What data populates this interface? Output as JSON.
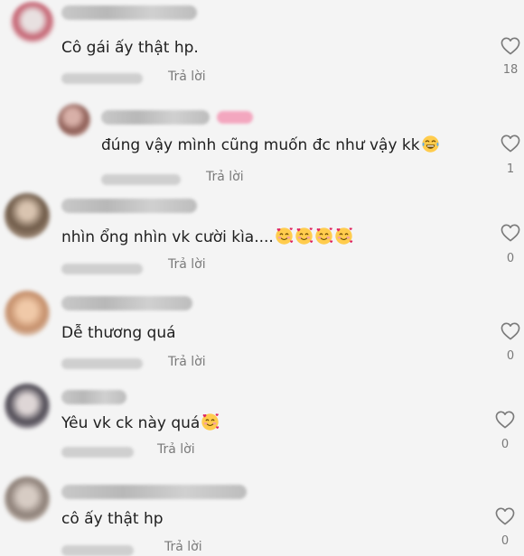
{
  "comments": [
    {
      "text": "Cô gái ấy thật hp.",
      "reply_label": "Trả lời",
      "likes": "18",
      "icon": "heart-outline-icon"
    },
    {
      "text": "đúng vậy mình cũng muốn đc như vậy kk",
      "reply_label": "Trả lời",
      "likes": "1",
      "icon": "heart-outline-icon",
      "emoji": "laughing-tears-emoji"
    },
    {
      "text": "nhìn ổng nhìn vk cười kìa....",
      "reply_label": "Trả lời",
      "likes": "0",
      "icon": "heart-outline-icon",
      "emoji": "smiling-face-with-hearts-emoji"
    },
    {
      "text": "Dễ thương quá",
      "reply_label": "Trả lời",
      "likes": "0",
      "icon": "heart-outline-icon"
    },
    {
      "text": "Yêu vk ck này quá",
      "reply_label": "Trả lời",
      "likes": "0",
      "icon": "heart-outline-icon",
      "emoji": "smiling-face-with-hearts-emoji"
    },
    {
      "text": "cô ấy thật hp",
      "reply_label": "Trả lời",
      "likes": "0",
      "icon": "heart-outline-icon"
    }
  ]
}
